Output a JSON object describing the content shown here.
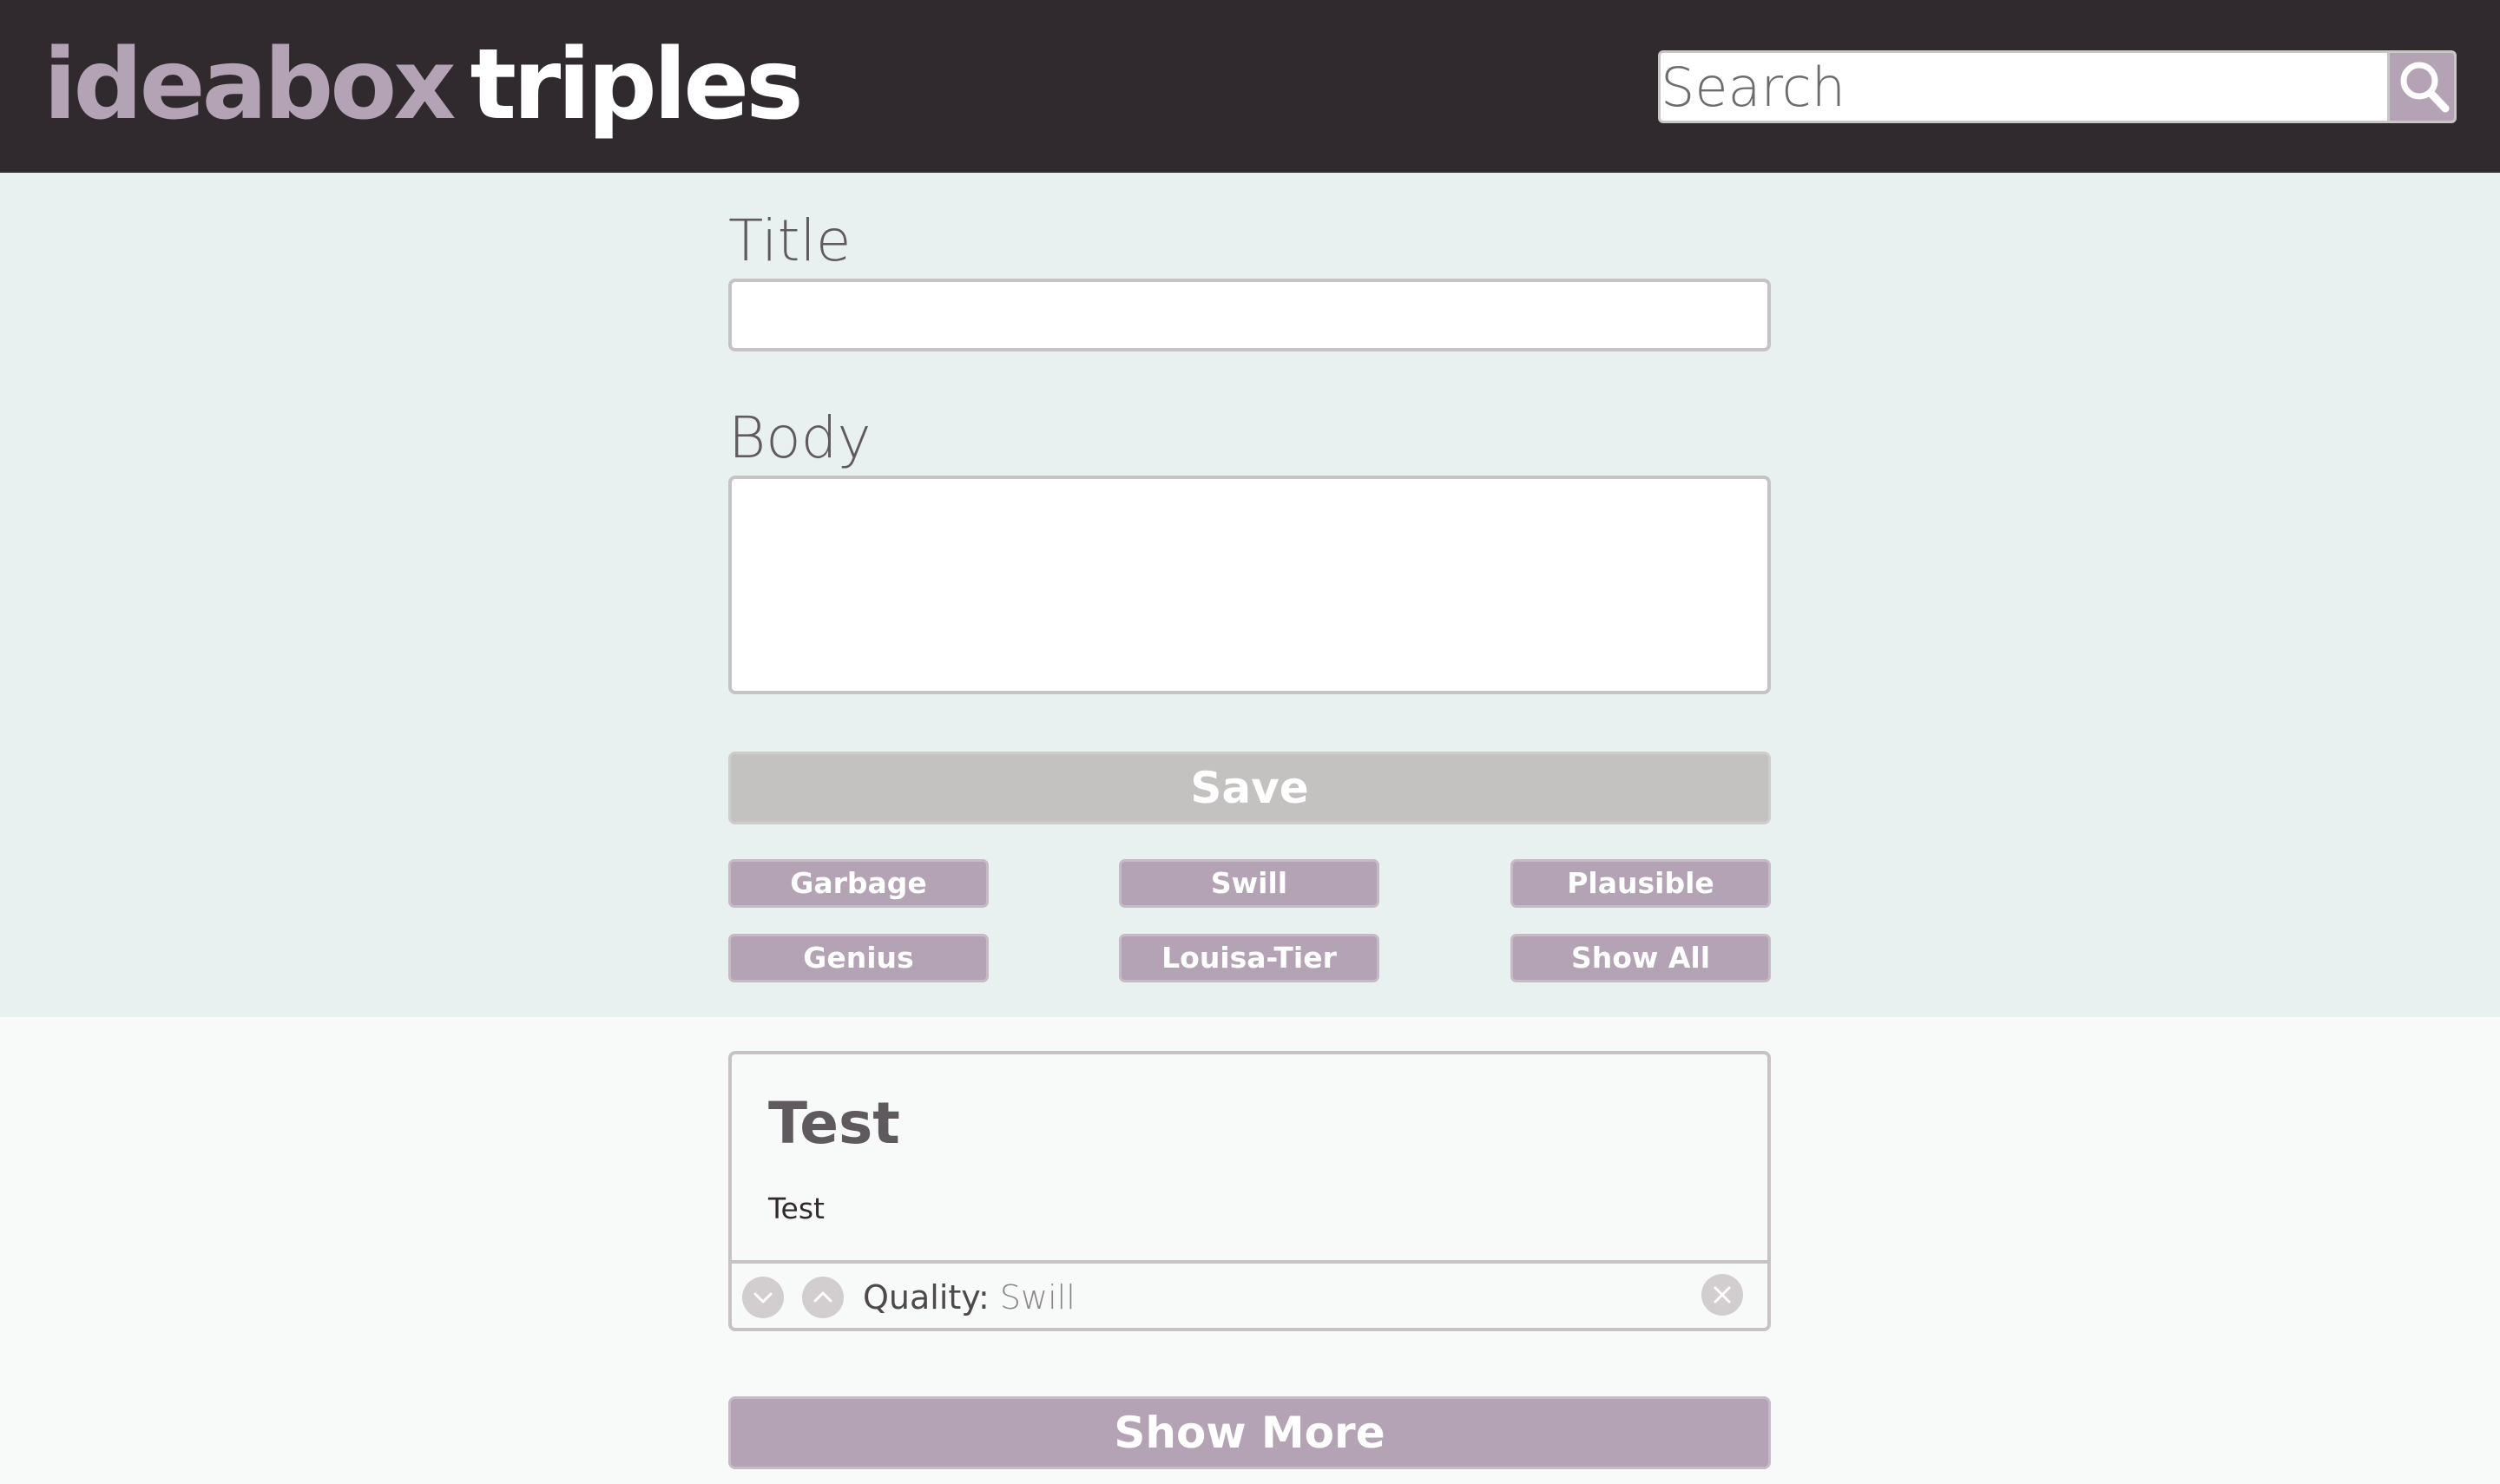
{
  "app": {
    "logo_first": "ideabox",
    "logo_second": "triples"
  },
  "search": {
    "placeholder": "Search",
    "value": "",
    "button_icon": "search-icon"
  },
  "form": {
    "title_label": "Title",
    "title_value": "",
    "body_label": "Body",
    "body_value": "",
    "save_label": "Save"
  },
  "filters": [
    {
      "label": "Garbage"
    },
    {
      "label": "Swill"
    },
    {
      "label": "Plausible"
    },
    {
      "label": "Genius"
    },
    {
      "label": "Louisa-Tier"
    },
    {
      "label": "Show All"
    }
  ],
  "ideas": [
    {
      "title": "Test",
      "body": "Test",
      "quality_label": "Quality:",
      "quality_value": "Swill",
      "downvote_icon": "chevron-down-icon",
      "upvote_icon": "chevron-up-icon",
      "delete_icon": "close-icon"
    }
  ],
  "show_more_label": "Show More",
  "colors": {
    "header_bg": "#302a2f",
    "accent": "#b3a3b4",
    "form_bg": "#e9f1f0",
    "page_bg": "#f8faf9",
    "save_disabled": "#c4c2c1"
  }
}
